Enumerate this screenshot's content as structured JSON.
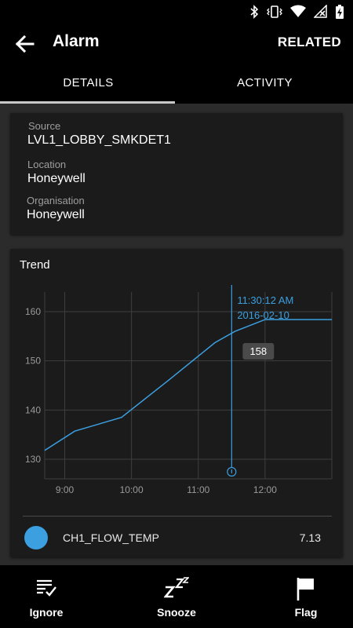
{
  "status_bar": {
    "icons": [
      "bluetooth-icon",
      "vibrate-icon",
      "wifi-icon",
      "no-signal-icon",
      "battery-charging-icon"
    ]
  },
  "app_bar": {
    "title": "Alarm",
    "related_label": "RELATED"
  },
  "tabs": [
    {
      "label": "DETAILS",
      "selected": true
    },
    {
      "label": "ACTIVITY",
      "selected": false
    }
  ],
  "details": {
    "source_label": "Source",
    "source_value": "LVL1_LOBBY_SMKDET1",
    "location_label": "Location",
    "location_value": "Honeywell",
    "organisation_label": "Organisation",
    "organisation_value": "Honeywell"
  },
  "trend": {
    "title": "Trend",
    "cursor_time": "11:30:12 AM",
    "cursor_date": "2016-02-10",
    "cursor_value_label": "158",
    "legend": {
      "name": "CH1_FLOW_TEMP",
      "value": "7.13",
      "color": "#3b9fe0"
    }
  },
  "chart_data": {
    "type": "line",
    "x_tick_labels": [
      "9:00",
      "10:00",
      "11:00",
      "12:00"
    ],
    "y_tick_labels": [
      "130",
      "140",
      "150",
      "160"
    ],
    "ylim": [
      126,
      164
    ],
    "x_range_hours": [
      8.7,
      13.0
    ],
    "grid": true,
    "series": [
      {
        "name": "CH1_FLOW_TEMP",
        "color": "#3b9fe0",
        "x": [
          8.7,
          9.15,
          9.85,
          10.55,
          11.25,
          11.55,
          12.0,
          13.0
        ],
        "y": [
          131.8,
          135.7,
          138.5,
          146.0,
          153.7,
          156.0,
          158.4,
          158.4
        ]
      }
    ],
    "cursor": {
      "x": 11.5,
      "value": 158
    }
  },
  "bottom_bar": [
    {
      "label": "Ignore",
      "icon": "checklist-icon"
    },
    {
      "label": "Snooze",
      "icon": "zzz-icon"
    },
    {
      "label": "Flag",
      "icon": "flag-icon"
    }
  ]
}
